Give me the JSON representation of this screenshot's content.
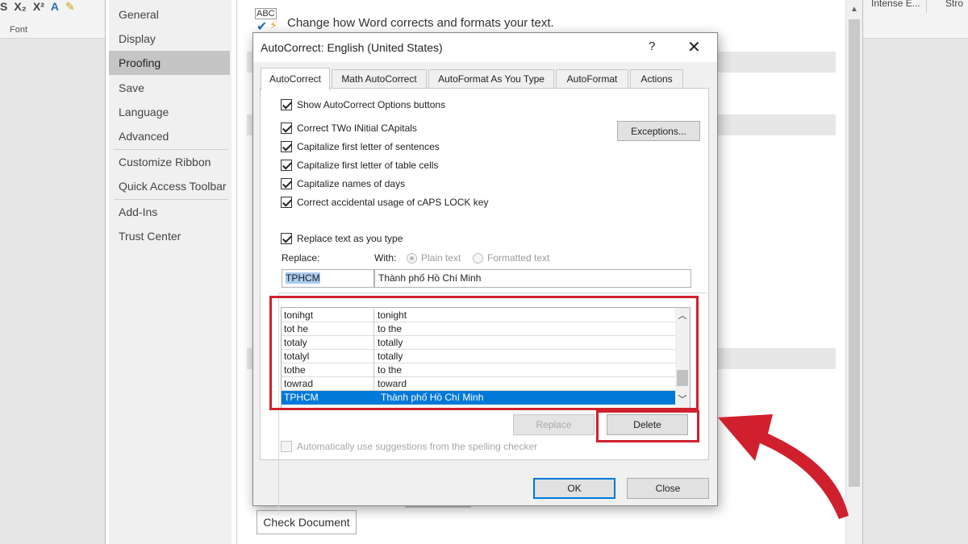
{
  "ribbon": {
    "icons": [
      "S",
      "X₂",
      "X²",
      "A",
      "✎"
    ],
    "font_group_label": "Font",
    "style_1": "Intense E...",
    "style_2": "Stro"
  },
  "options_nav": {
    "items": [
      {
        "label": "General"
      },
      {
        "label": "Display"
      },
      {
        "label": "Proofing",
        "active": true
      },
      {
        "label": "Save"
      },
      {
        "label": "Language"
      },
      {
        "label": "Advanced"
      },
      {
        "label": "Customize Ribbon"
      },
      {
        "label": "Quick Access Toolbar"
      },
      {
        "label": "Add-Ins"
      },
      {
        "label": "Trust Center"
      }
    ]
  },
  "options_content": {
    "icon_text": "ABC",
    "header": "Change how Word corrects and formats your text.",
    "check_document_label": "Check Document"
  },
  "dialog": {
    "title": "AutoCorrect: English (United States)",
    "help_label": "?",
    "close_label": "✕",
    "tabs": [
      {
        "label": "AutoCorrect",
        "active": true
      },
      {
        "label": "Math AutoCorrect"
      },
      {
        "label": "AutoFormat As You Type"
      },
      {
        "label": "AutoFormat"
      },
      {
        "label": "Actions"
      }
    ],
    "checkboxes": {
      "show_options": "Show AutoCorrect Options buttons",
      "two_initials": "Correct TWo INitial CApitals",
      "first_letter_sentences": "Capitalize first letter of sentences",
      "first_letter_cells": "Capitalize first letter of table cells",
      "names_of_days": "Capitalize names of days",
      "caps_lock": "Correct accidental usage of cAPS LOCK key",
      "replace_as_type": "Replace text as you type",
      "auto_suggestions": "Automatically use suggestions from the spelling checker"
    },
    "exceptions_label": "Exceptions...",
    "replace_label": "Replace:",
    "with_label": "With:",
    "plain_text_label": "Plain text",
    "formatted_text_label": "Formatted text",
    "replace_value": "TPHCM",
    "with_value": "Thành phố Hồ Chí Minh",
    "entries": [
      {
        "from": "tonihgt",
        "to": "tonight"
      },
      {
        "from": "tot he",
        "to": "to the"
      },
      {
        "from": "totaly",
        "to": "totally"
      },
      {
        "from": "totalyl",
        "to": "totally"
      },
      {
        "from": "tothe",
        "to": "to the"
      },
      {
        "from": "towrad",
        "to": "toward"
      },
      {
        "from": "TPHCM",
        "to": "Thành phố Hồ Chí Minh",
        "selected": true
      }
    ],
    "replace_button": "Replace",
    "delete_button": "Delete",
    "ok_button": "OK",
    "close_button": "Close"
  },
  "colors": {
    "highlight": "#d0202e",
    "selection": "#0078d7"
  }
}
